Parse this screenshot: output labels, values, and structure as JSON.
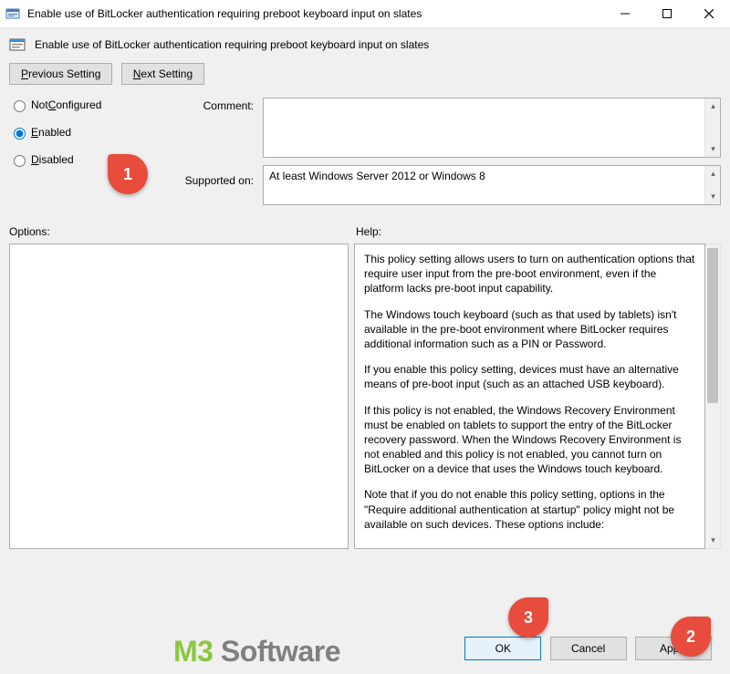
{
  "titlebar": {
    "title": "Enable use of BitLocker authentication requiring preboot keyboard input on slates"
  },
  "policy": {
    "title": "Enable use of BitLocker authentication requiring preboot keyboard input on slates"
  },
  "nav": {
    "previous_prefix": "P",
    "previous_rest": "revious Setting",
    "next_prefix": "N",
    "next_rest": "ext Setting"
  },
  "state": {
    "not_configured_rest": "onfigured",
    "not_configured_prefix": "Not ",
    "not_configured_u": "C",
    "enabled_u": "E",
    "enabled_rest": "nabled",
    "disabled_u": "D",
    "disabled_rest": "isabled",
    "selected": "enabled"
  },
  "labels": {
    "comment": "Comment:",
    "supported_on": "Supported on:",
    "options": "Options:",
    "help": "Help:"
  },
  "supported_text": "At least Windows Server 2012 or Windows 8",
  "help_paragraphs": [
    "This policy setting allows users to turn on authentication options that require user input from the pre-boot environment, even if the platform lacks pre-boot input capability.",
    "The Windows touch keyboard (such as that used by tablets) isn't available in the pre-boot environment where BitLocker requires additional information such as a PIN or Password.",
    "If you enable this policy setting, devices must have an alternative means of pre-boot input (such as an attached USB keyboard).",
    "If this policy is not enabled, the Windows Recovery Environment must be enabled on tablets to support the entry of the BitLocker recovery password. When the Windows Recovery Environment is not enabled and this policy is not enabled, you cannot turn on BitLocker on a device that uses the Windows touch keyboard.",
    "Note that if you do not enable this policy setting, options in the \"Require additional authentication at startup\" policy might not be available on such devices. These options include:"
  ],
  "buttons": {
    "ok": "OK",
    "cancel": "Cancel",
    "apply": "Apply"
  },
  "annotations": {
    "a1": "1",
    "a2": "2",
    "a3": "3"
  },
  "watermark": {
    "m3": "M3",
    "sw": " Software"
  }
}
